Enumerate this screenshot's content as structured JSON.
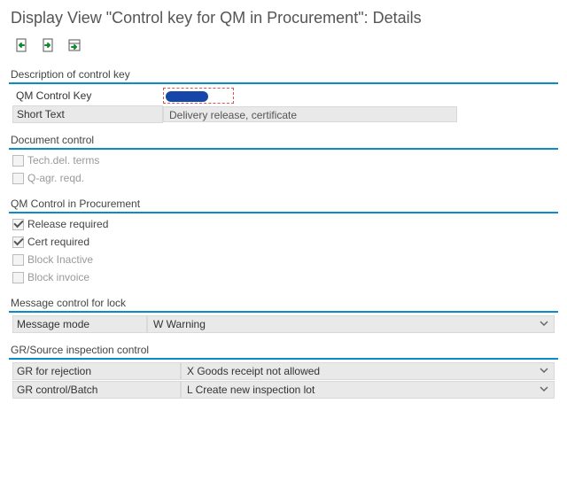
{
  "title": "Display View \"Control key for QM in Procurement\": Details",
  "sections": {
    "description": {
      "title": "Description of control key",
      "qm_key_label": "QM Control Key",
      "qm_key_value": "",
      "short_text_label": "Short Text",
      "short_text_value": "Delivery release, certificate"
    },
    "doc_control": {
      "title": "Document control",
      "tech_del_terms": {
        "label": "Tech.del. terms",
        "checked": false
      },
      "q_agr_reqd": {
        "label": "Q-agr. reqd.",
        "checked": false
      }
    },
    "qm_proc": {
      "title": "QM Control in Procurement",
      "release_required": {
        "label": "Release required",
        "checked": true
      },
      "cert_required": {
        "label": "Cert required",
        "checked": true
      },
      "block_inactive": {
        "label": "Block Inactive",
        "checked": false
      },
      "block_invoice": {
        "label": "Block invoice",
        "checked": false
      }
    },
    "msg_control": {
      "title": "Message control for lock",
      "message_mode_label": "Message mode",
      "message_mode_value": "W Warning"
    },
    "gr_source": {
      "title": "GR/Source inspection control",
      "gr_rejection_label": "GR for rejection",
      "gr_rejection_value": "X Goods receipt not allowed",
      "gr_control_label": "GR control/Batch",
      "gr_control_value": "L Create new inspection lot"
    }
  }
}
